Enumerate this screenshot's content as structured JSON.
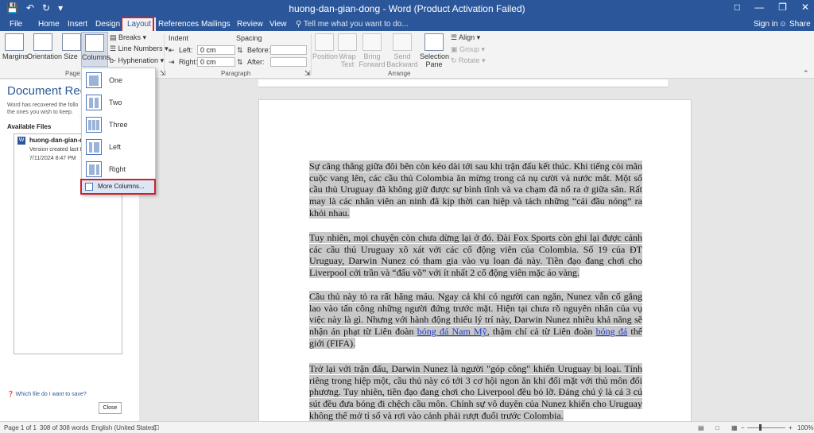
{
  "titlebar": {
    "title": "huong-dan-gian-dong - Word (Product Activation Failed)",
    "save_icon": "save-icon",
    "undo_icon": "undo-icon",
    "redo_icon": "redo-icon",
    "ribbon_display_icon": "ribbon-display-icon",
    "minimize_icon": "minimize-icon",
    "restore_icon": "restore-icon",
    "close_icon": "close-icon"
  },
  "tabs": {
    "file": "File",
    "home": "Home",
    "insert": "Insert",
    "design": "Design",
    "layout": "Layout",
    "references": "References",
    "mailings": "Mailings",
    "review": "Review",
    "view": "View",
    "tell_me": "Tell me what you want to do...",
    "sign_in": "Sign in",
    "share": "Share"
  },
  "ribbon": {
    "margins": "Margins",
    "orientation": "Orientation",
    "size": "Size",
    "columns": "Columns",
    "breaks": "Breaks",
    "line_numbers": "Line Numbers",
    "hyphenation": "Hyphenation",
    "page_setup_group": "Page S",
    "indent_header": "Indent",
    "spacing_header": "Spacing",
    "left_label": "Left:",
    "right_label": "Right:",
    "before_label": "Before:",
    "after_label": "After:",
    "indent_left": "0 cm",
    "indent_right": "0 cm",
    "paragraph_group": "Paragraph",
    "position": "Position",
    "wrap_text": "Wrap Text",
    "bring_forward": "Bring Forward",
    "send_backward": "Send Backward",
    "selection_pane": "Selection Pane",
    "align": "Align",
    "group": "Group",
    "rotate": "Rotate",
    "arrange_group": "Arrange"
  },
  "left_pane": {
    "heading": "Document Reco",
    "subtitle": "Word has recovered the follo the ones you wish to keep.",
    "available_files": "Available Files",
    "file_name": "huong-dan-gian-d",
    "file_version": "Version created last t",
    "file_date": "7/11/2024 8:47 PM",
    "help_link": "Which file do I want to save?",
    "close_button": "Close"
  },
  "columns_menu": {
    "items": [
      "One",
      "Two",
      "Three",
      "Left",
      "Right"
    ],
    "more": "More Columns..."
  },
  "document": {
    "paragraphs": [
      "Sự căng thẳng giữa đôi bên còn kéo dài tới sau khi trận đấu kết thúc. Khi tiếng còi mãn cuộc vang lên, các cầu thủ Colombia ăn mừng trong cả nụ cười và nước mắt. Một số cầu thủ Uruguay đã không giữ được sự bình tĩnh và va chạm đã nổ ra ở giữa sân. Rất may là các nhân viên an ninh đã kịp thời can hiệp và tách những “cái đầu nóng” ra khỏi nhau.",
      "Tuy nhiên, mọi chuyện còn chưa dừng lại ở đó. Đài Fox Sports còn ghi lại được cảnh các cầu thủ Uruguay xô xát với các cổ động viên của Colombia. Số 19 của ĐT Uruguay, Darwin Nunez có tham gia vào vụ loạn đả này. Tiền đạo đang chơi cho Liverpool cởi trần và “đấu võ” với ít nhất 2 cổ động viên mặc áo vàng.",
      "Cầu thủ này tỏ ra rất hăng máu. Ngay cả khi có người can ngăn, Nunez vẫn cố gắng lao vào tấn công những người đứng trước mặt. Hiện tại chưa rõ nguyên nhân của vụ việc này là gì. Nhưng với hành động thiếu lý trí này, Darwin Nunez nhiều khả năng sẽ nhận án phạt từ Liên đoàn",
      "Trở lại với trận đấu, Darwin Nunez là người \"góp công\" khiến Uruguay bị loại. Tính riêng trong hiệp một, cầu thủ này có tới 3 cơ hội ngon ăn khi đối mặt với thủ môn đối phương. Tuy nhiên, tiền đạo đang chơi cho Liverpool đều bỏ lỡ. Đáng chú ý là cả 3 cú sút đều đưa bóng đi chệch cầu môn. Chính sự vô duyên của Nunez khiến cho Uruguay không thể mở tỉ số và rơi vào cảnh phải rượt đuổi trước Colombia."
    ],
    "link1": "bóng đá Nam Mỹ",
    "mid3": ", thậm chí cả từ Liên đoàn",
    "link2": "bóng đá",
    "end3": " thế giới (FIFA)."
  },
  "status": {
    "page": "Page 1 of 1",
    "words": "308 of 308 words",
    "language": "English (United States)",
    "zoom": "100%"
  }
}
